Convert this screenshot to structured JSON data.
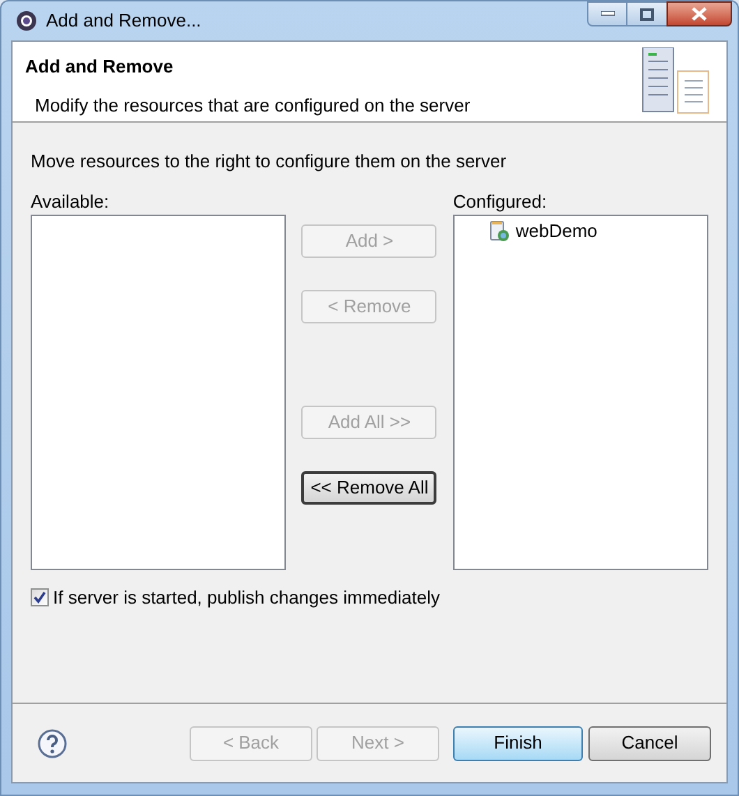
{
  "window": {
    "title": "Add and Remove..."
  },
  "header": {
    "title": "Add and Remove",
    "description": "Modify the resources that are configured on the server"
  },
  "instruction": "Move resources to the right to configure them on the server",
  "available": {
    "label": "Available:"
  },
  "configured": {
    "label": "Configured:",
    "items": [
      {
        "label": "webDemo"
      }
    ]
  },
  "move_buttons": [
    {
      "label": "Add >",
      "disabled": true,
      "focused": false
    },
    {
      "label": "< Remove",
      "disabled": true,
      "focused": false
    },
    {
      "label": "Add All >>",
      "disabled": true,
      "focused": false
    },
    {
      "label": "<< Remove All",
      "disabled": false,
      "focused": true
    }
  ],
  "publish_option": {
    "label": "If server is started, publish changes immediately",
    "checked": true
  },
  "footer_buttons": [
    {
      "label": "< Back",
      "disabled": true,
      "default": false
    },
    {
      "label": "Next >",
      "disabled": true,
      "default": false
    },
    {
      "label": "Finish",
      "disabled": false,
      "default": true
    },
    {
      "label": "Cancel",
      "disabled": false,
      "default": false
    }
  ]
}
